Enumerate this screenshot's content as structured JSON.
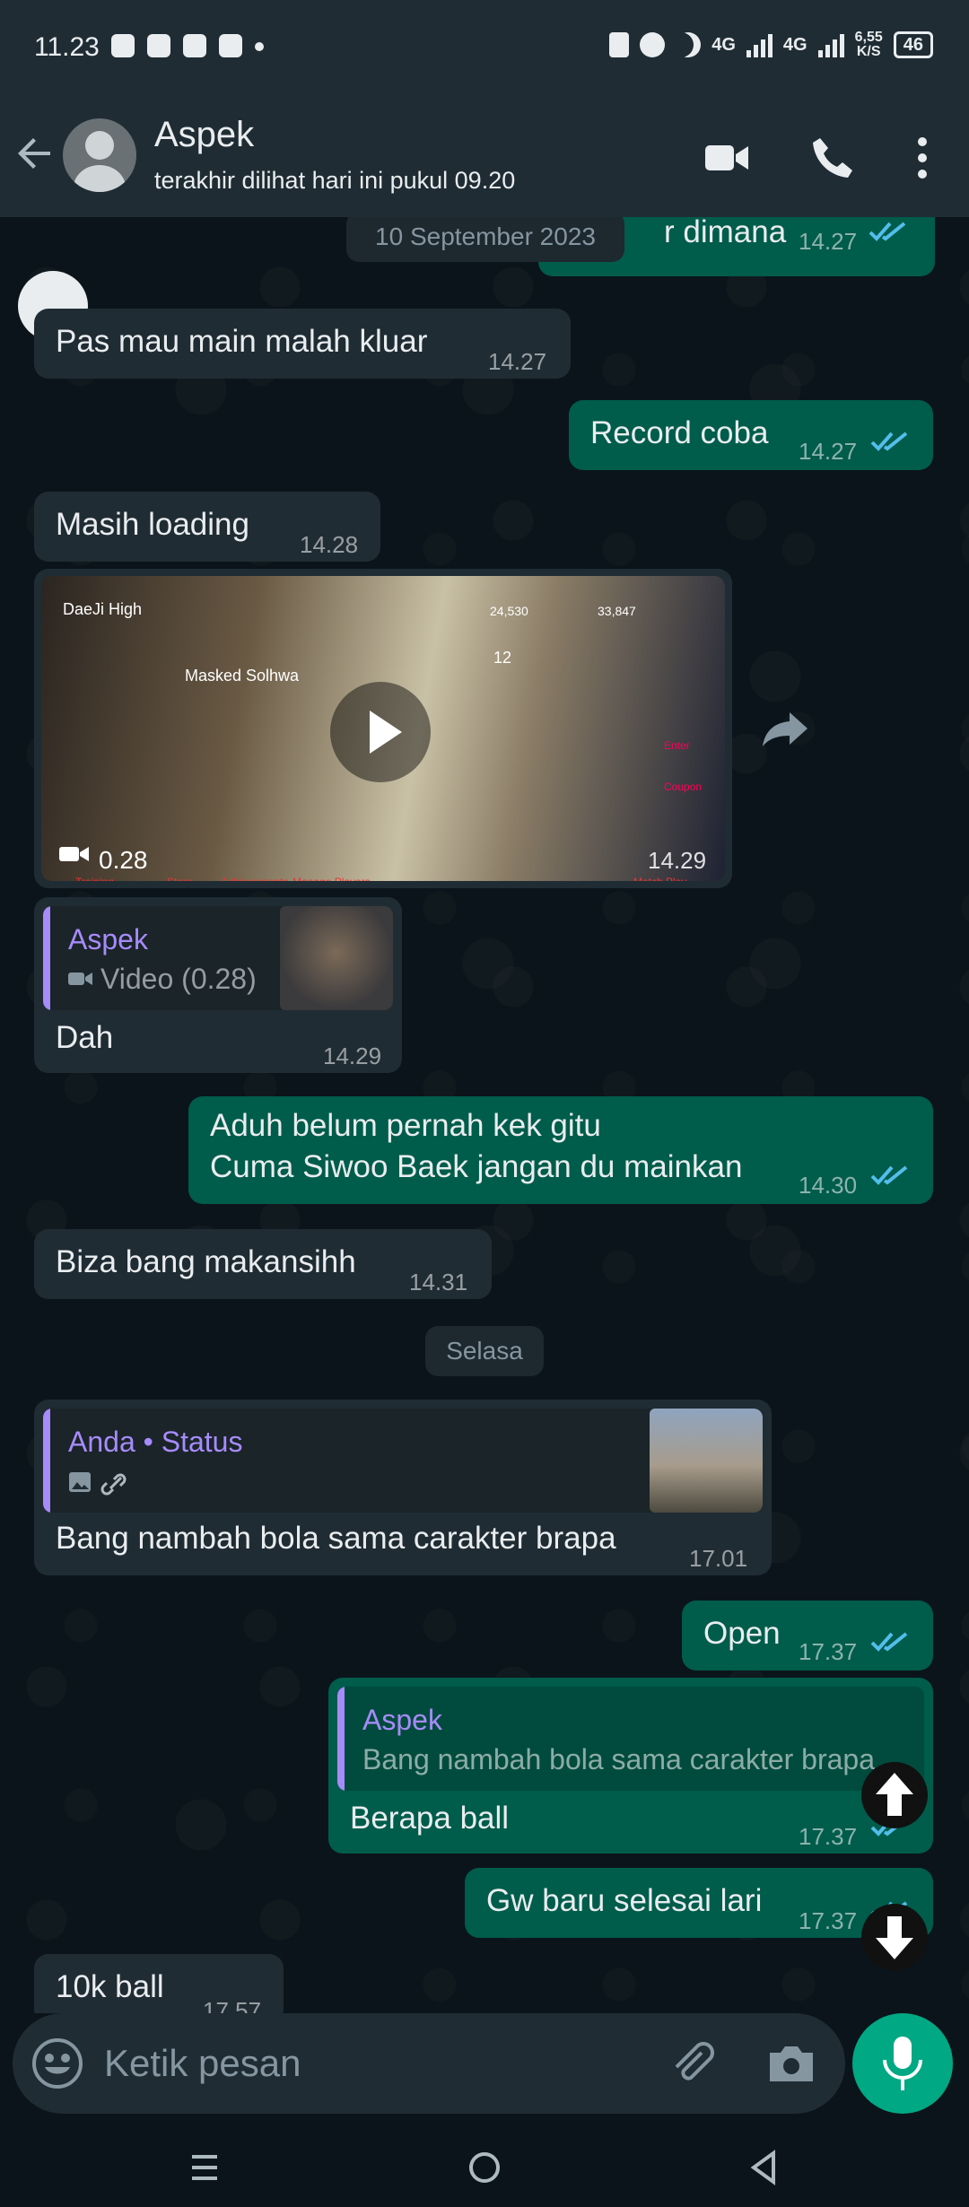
{
  "statusbar": {
    "time": "11.23",
    "network_label_1": "4G",
    "network_label_2": "4G",
    "speed": "6,55",
    "speed_unit": "K/S",
    "battery": "46"
  },
  "header": {
    "contact_name": "Aspek",
    "last_seen": "terakhir dilihat hari ini pukul 09.20"
  },
  "chat": {
    "date_chip_1": "10 September 2023",
    "date_chip_2": "Selasa",
    "messages": [
      {
        "text": "r dimana",
        "time": "14.27"
      },
      {
        "text": "Pas mau main malah kluar",
        "time": "14.27"
      },
      {
        "text": "Record coba",
        "time": "14.27"
      },
      {
        "text": "Masih loading",
        "time": "14.28"
      },
      {
        "video_duration": "0.28",
        "time": "14.29",
        "game_labels": [
          "DaeJi High",
          "Masked Solhwa",
          "Training",
          "Store",
          "Achievements",
          "Manage Players",
          "Match Play",
          "Enter Coupon",
          "24,530",
          "33,847",
          "12"
        ]
      },
      {
        "quote_author": "Aspek",
        "quote_text": "Video (0.28)",
        "text": "Dah",
        "time": "14.29"
      },
      {
        "line1": "Aduh belum pernah kek gitu",
        "line2": "Cuma Siwoo Baek jangan du mainkan",
        "time": "14.30"
      },
      {
        "text": "Biza bang makansihh",
        "time": "14.31"
      },
      {
        "quote_author": "Anda • Status",
        "text": "Bang nambah bola sama carakter brapa",
        "time": "17.01"
      },
      {
        "text": "Open",
        "time": "17.37"
      },
      {
        "quote_author": "Aspek",
        "quote_text": "Bang nambah bola sama carakter brapa",
        "text": "Berapa ball",
        "time": "17.37"
      },
      {
        "text": "Gw baru selesai lari",
        "time": "17.37"
      },
      {
        "text": "10k ball",
        "time": "17.57"
      }
    ]
  },
  "input": {
    "placeholder": "Ketik pesan"
  },
  "colors": {
    "incoming": "#202c33",
    "outgoing": "#005c4b",
    "accent": "#00a884",
    "read_ticks": "#53bdeb",
    "quote_accent": "#a78bfa"
  }
}
